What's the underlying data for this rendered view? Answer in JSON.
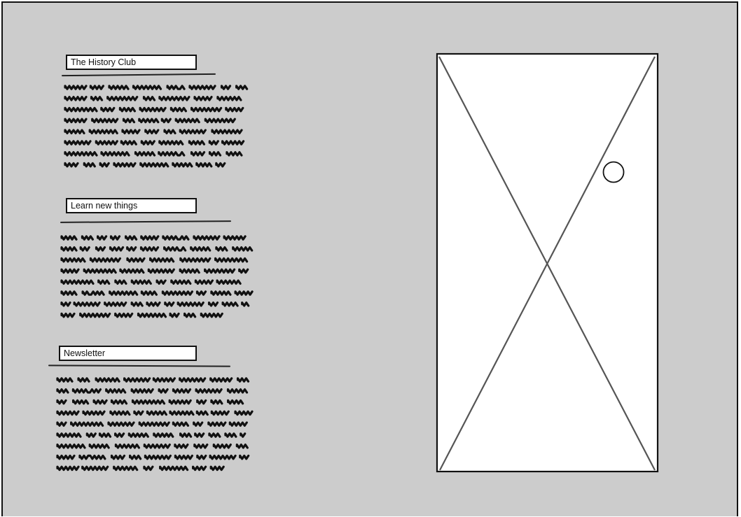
{
  "sections": [
    {
      "title": "The History Club",
      "lines": 8
    },
    {
      "title": "Learn new things",
      "lines": 8
    },
    {
      "title": "Newsletter",
      "lines": 9
    }
  ],
  "image_placeholder": {
    "icon": "image-placeholder-icon"
  },
  "colors": {
    "background": "#cccccc",
    "ink": "#111111",
    "panel": "#ffffff"
  }
}
